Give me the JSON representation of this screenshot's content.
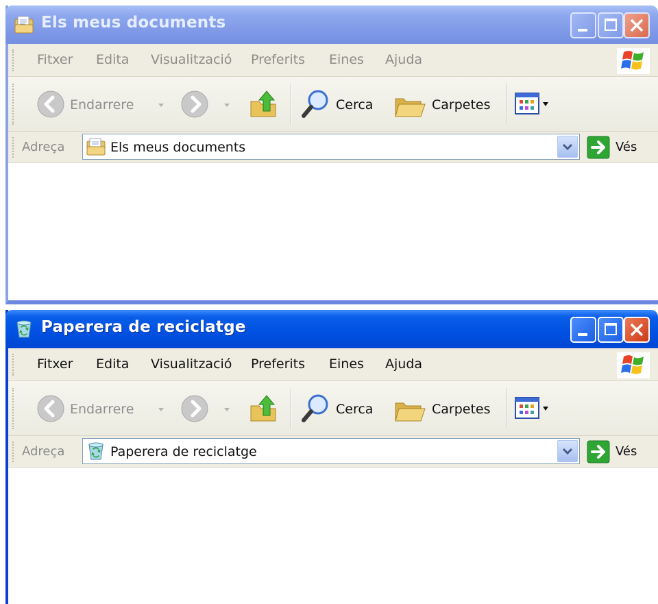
{
  "windows": [
    {
      "title": "Els meus documents",
      "state": "inactive",
      "menu": [
        "Fitxer",
        "Edita",
        "Visualització",
        "Preferits",
        "Eines",
        "Ajuda"
      ],
      "toolbar": {
        "back_label": "Endarrere",
        "search_label": "Cerca",
        "folders_label": "Carpetes"
      },
      "address": {
        "label": "Adreça",
        "value": "Els meus documents",
        "icon": "documents-folder-icon",
        "go_label": "Vés"
      }
    },
    {
      "title": "Paperera de reciclatge",
      "state": "active",
      "menu": [
        "Fitxer",
        "Edita",
        "Visualització",
        "Preferits",
        "Eines",
        "Ajuda"
      ],
      "toolbar": {
        "back_label": "Endarrere",
        "search_label": "Cerca",
        "folders_label": "Carpetes"
      },
      "address": {
        "label": "Adreça",
        "value": "Paperera de reciclatge",
        "icon": "recycle-bin-icon",
        "go_label": "Vés"
      }
    }
  ],
  "colors": {
    "active_title": "#0054e3",
    "inactive_title": "#7a96df",
    "close_button": "#d8482a",
    "toolbar_bg": "#efede2",
    "go_green": "#2fa534"
  }
}
